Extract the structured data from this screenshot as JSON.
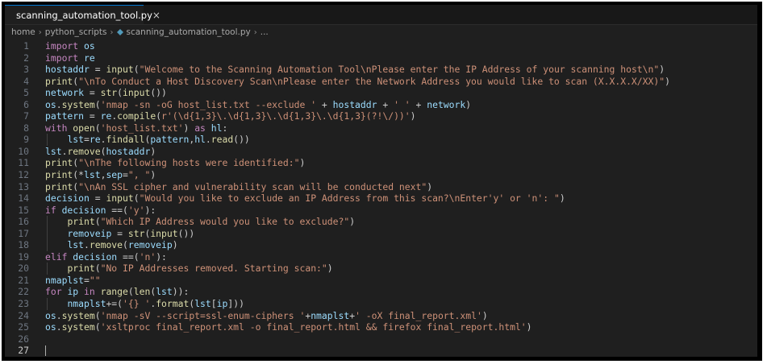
{
  "tab": {
    "filename": "scanning_automation_tool.py",
    "close_label": "×"
  },
  "breadcrumb": {
    "root": "home",
    "folder": "python_scripts",
    "file": "scanning_automation_tool.py",
    "more": "..."
  },
  "editor": {
    "active_line": 27,
    "lines": [
      {
        "n": "1",
        "t": "import os"
      },
      {
        "n": "2",
        "t": "import re"
      },
      {
        "n": "3",
        "t": "hostaddr = input(\"Welcome to the Scanning Automation Tool\\nPlease enter the IP Address of your scanning host\\n\")"
      },
      {
        "n": "4",
        "t": "print(\"\\nTo Conduct a Host Discovery Scan\\nPlease enter the Network Address you would like to scan (X.X.X.X/XX)\")"
      },
      {
        "n": "5",
        "t": "network = str(input())"
      },
      {
        "n": "6",
        "t": "os.system('nmap -sn -oG host_list.txt --exclude ' + hostaddr + ' ' + network)"
      },
      {
        "n": "7",
        "t": "pattern = re.compile(r'(\\d{1,3}\\.\\d{1,3}\\.\\d{1,3}\\.\\d{1,3}(?!\\/))')"
      },
      {
        "n": "8",
        "t": "with open('host_list.txt') as hl:"
      },
      {
        "n": "9",
        "t": "    lst=re.findall(pattern,hl.read())"
      },
      {
        "n": "10",
        "t": "lst.remove(hostaddr)"
      },
      {
        "n": "11",
        "t": "print(\"\\nThe following hosts were identified:\")"
      },
      {
        "n": "12",
        "t": "print(*lst,sep=\", \")"
      },
      {
        "n": "13",
        "t": "print(\"\\nAn SSL cipher and vulnerability scan will be conducted next\")"
      },
      {
        "n": "14",
        "t": "decision = input(\"Would you like to exclude an IP Address from this scan?\\nEnter'y' or 'n': \")"
      },
      {
        "n": "15",
        "t": "if decision ==('y'):"
      },
      {
        "n": "16",
        "t": "    print(\"Which IP Address would you like to exclude?\")"
      },
      {
        "n": "17",
        "t": "    removeip = str(input())"
      },
      {
        "n": "18",
        "t": "    lst.remove(removeip)"
      },
      {
        "n": "19",
        "t": "elif decision ==('n'):"
      },
      {
        "n": "20",
        "t": "    print(\"No IP Addresses removed. Starting scan:\")"
      },
      {
        "n": "21",
        "t": "nmaplst=\"\""
      },
      {
        "n": "22",
        "t": "for ip in range(len(lst)):"
      },
      {
        "n": "23",
        "t": "    nmaplst+=('{} '.format(lst[ip]))"
      },
      {
        "n": "24",
        "t": "os.system('nmap -sV --script=ssl-enum-ciphers '+nmaplst+' -oX final_report.xml')"
      },
      {
        "n": "25",
        "t": "os.system('xsltproc final_report.xml -o final_report.html && firefox final_report.html')"
      },
      {
        "n": "26",
        "t": ""
      },
      {
        "n": "27",
        "t": ""
      }
    ]
  }
}
